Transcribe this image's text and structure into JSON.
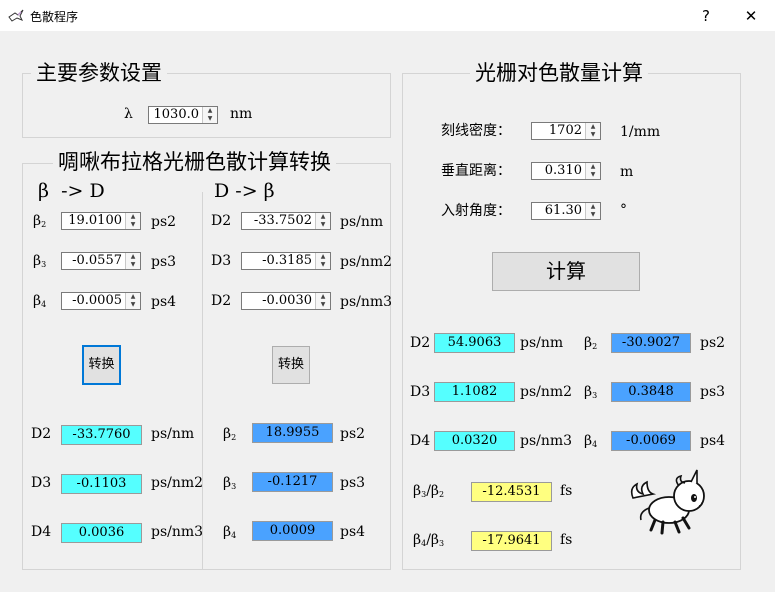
{
  "window": {
    "title": "色散程序",
    "help_label": "?",
    "close_label": "✕"
  },
  "main_params": {
    "title": "主要参数设置",
    "lambda_label": "λ",
    "lambda_value": "1030.0",
    "lambda_unit": "nm"
  },
  "conversion": {
    "title": "啁啾布拉格光栅色散计算转换",
    "beta_to_d_header": "β  -> D",
    "d_to_beta_header": "D -> β",
    "convert_label": "转换",
    "left_inputs": [
      {
        "name": "β",
        "sub": "2",
        "value": "19.0100",
        "unit": "ps2"
      },
      {
        "name": "β",
        "sub": "3",
        "value": "-0.0557",
        "unit": "ps3"
      },
      {
        "name": "β",
        "sub": "4",
        "value": "-0.0005",
        "unit": "ps4"
      }
    ],
    "right_inputs": [
      {
        "name": "D2",
        "value": "-33.7502",
        "unit": "ps/nm"
      },
      {
        "name": "D3",
        "value": "-0.3185",
        "unit": "ps/nm2"
      },
      {
        "name": "D2",
        "value": "-0.0030",
        "unit": "ps/nm3"
      }
    ],
    "left_outputs": [
      {
        "name": "D2",
        "value": "-33.7760",
        "unit": "ps/nm"
      },
      {
        "name": "D3",
        "value": "-0.1103",
        "unit": "ps/nm2"
      },
      {
        "name": "D4",
        "value": "0.0036",
        "unit": "ps/nm3"
      }
    ],
    "right_outputs": [
      {
        "name": "β",
        "sub": "2",
        "value": "18.9955",
        "unit": "ps2"
      },
      {
        "name": "β",
        "sub": "3",
        "value": "-0.1217",
        "unit": "ps3"
      },
      {
        "name": "β",
        "sub": "4",
        "value": "0.0009",
        "unit": "ps4"
      }
    ]
  },
  "grating": {
    "title": "光栅对色散量计算",
    "line_density_label": "刻线密度：",
    "line_density_value": "1702",
    "line_density_unit": "1/mm",
    "distance_label": "垂直距离：",
    "distance_value": "0.310",
    "distance_unit": "m",
    "angle_label": "入射角度：",
    "angle_value": "61.30",
    "angle_unit": "°",
    "calc_label": "计算",
    "d_results": [
      {
        "name": "D2",
        "value": "54.9063",
        "unit": "ps/nm"
      },
      {
        "name": "D3",
        "value": "1.1082",
        "unit": "ps/nm2"
      },
      {
        "name": "D4",
        "value": "0.0320",
        "unit": "ps/nm3"
      }
    ],
    "beta_results": [
      {
        "name": "β",
        "sub": "2",
        "value": "-30.9027",
        "unit": "ps2"
      },
      {
        "name": "β",
        "sub": "3",
        "value": "0.3848",
        "unit": "ps3"
      },
      {
        "name": "β",
        "sub": "4",
        "value": "-0.0069",
        "unit": "ps4"
      }
    ],
    "ratios": [
      {
        "num": "β",
        "num_sub": "3",
        "den": "β",
        "den_sub": "2",
        "value": "-12.4531",
        "unit": "fs"
      },
      {
        "num": "β",
        "num_sub": "4",
        "den": "β",
        "den_sub": "3",
        "value": "-17.9641",
        "unit": "fs"
      }
    ]
  },
  "icons": {
    "app": "unicorn-icon",
    "mascot": "unicorn-mascot"
  },
  "colors": {
    "output_cyan": "#55ffff",
    "output_blue": "#4aa2ff",
    "output_yellow": "#ffff80",
    "focus_blue": "#0078d7"
  }
}
